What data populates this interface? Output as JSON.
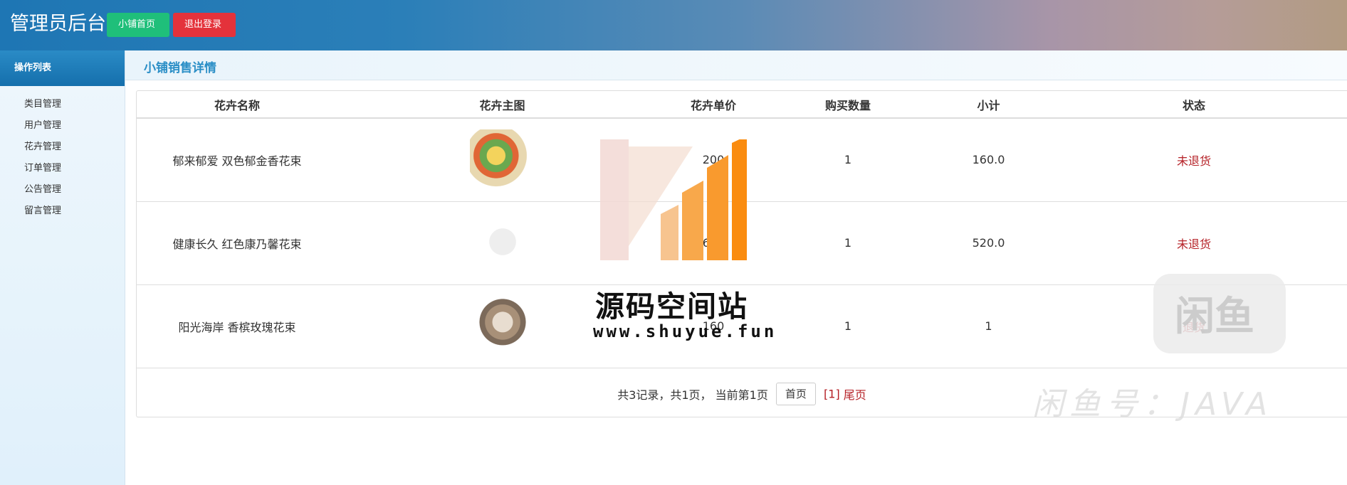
{
  "header": {
    "brand": "管理员后台",
    "home_label": "小铺首页",
    "logout_label": "退出登录",
    "glyph": ""
  },
  "sidebar": {
    "title": "操作列表",
    "items": [
      {
        "label": "类目管理"
      },
      {
        "label": "用户管理"
      },
      {
        "label": "花卉管理"
      },
      {
        "label": "订单管理"
      },
      {
        "label": "公告管理"
      },
      {
        "label": "留言管理"
      }
    ]
  },
  "main": {
    "title": "小铺销售详情",
    "columns": [
      "花卉名称",
      "花卉主图",
      "花卉单价",
      "购买数量",
      "小计",
      "状态"
    ],
    "rows": [
      {
        "name": "郁来郁爱 双色郁金香花束",
        "price": "200",
        "qty": "1",
        "subtotal": "160.0",
        "status": "未退货"
      },
      {
        "name": "健康长久 红色康乃馨花束",
        "price": "650",
        "qty": "1",
        "subtotal": "520.0",
        "status": "未退货"
      },
      {
        "name": "阳光海岸 香槟玫瑰花束",
        "price": "160",
        "qty": "1",
        "subtotal": "1",
        "status": "退货"
      }
    ],
    "pager": {
      "summary": "共3记录，共1页， 当前第1页",
      "first": "首页",
      "current": "[1]",
      "last": "尾页"
    }
  },
  "watermark": {
    "title": "源码空间站",
    "url": "www.shuyue.fun",
    "xianyu": "闲鱼",
    "java": "闲鱼号：JAVA"
  },
  "colors": {
    "green": "#1fbf7a",
    "red": "#e4323b",
    "status": "#b52026",
    "title_blue": "#2a8ec6"
  }
}
